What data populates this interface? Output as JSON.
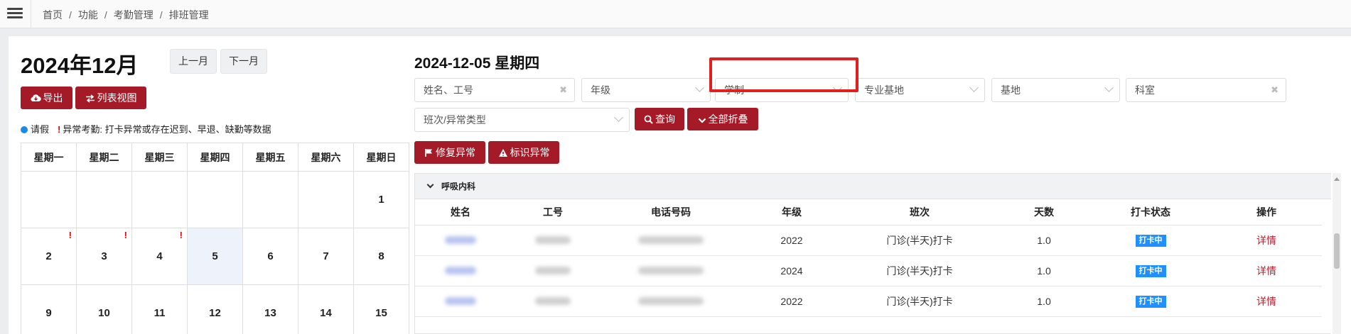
{
  "breadcrumb": [
    "首页",
    "功能",
    "考勤管理",
    "排班管理"
  ],
  "calendar": {
    "month_title": "2024年12月",
    "prev_label": "上一月",
    "next_label": "下一月",
    "export_label": "导出",
    "list_view_label": "列表视图",
    "legend_leave": "请假",
    "legend_abnormal": "异常考勤: 打卡异常或存在迟到、早退、缺勤等数据",
    "weekdays": [
      "星期一",
      "星期二",
      "星期三",
      "星期四",
      "星期五",
      "星期六",
      "星期日"
    ],
    "rows": [
      [
        "",
        "",
        "",
        "",
        "",
        "",
        "1"
      ],
      [
        "2",
        "3",
        "4",
        "5",
        "6",
        "7",
        "8"
      ],
      [
        "9",
        "10",
        "11",
        "12",
        "13",
        "14",
        "15"
      ]
    ],
    "flagged_days": [
      "2",
      "3",
      "4"
    ],
    "selected_day": "5"
  },
  "day_panel": {
    "date_title": "2024-12-05 星期四",
    "filters": {
      "name_placeholder": "姓名、工号",
      "grade_placeholder": "年级",
      "system_placeholder": "学制",
      "base_major_placeholder": "专业基地",
      "base_placeholder": "基地",
      "dept_placeholder": "科室",
      "shift_placeholder": "班次/异常类型"
    },
    "query_label": "查询",
    "collapse_label": "全部折叠",
    "fix_label": "修复异常",
    "mark_label": "标识异常",
    "group_name": "呼吸内科",
    "columns": [
      "姓名",
      "工号",
      "电话号码",
      "年级",
      "班次",
      "天数",
      "打卡状态",
      "操作"
    ],
    "rows": [
      {
        "grade": "2022",
        "shift": "门诊(半天)打卡",
        "days": "1.0",
        "status": "打卡中",
        "action": "详情"
      },
      {
        "grade": "2024",
        "shift": "门诊(半天)打卡",
        "days": "1.0",
        "status": "打卡中",
        "action": "详情"
      },
      {
        "grade": "2022",
        "shift": "门诊(半天)打卡",
        "days": "1.0",
        "status": "打卡中",
        "action": "详情"
      }
    ]
  },
  "colors": {
    "accent": "#a51a27",
    "badge": "#1e90ff",
    "highlight": "#e21f1f",
    "leave_dot": "#1e88e5"
  }
}
